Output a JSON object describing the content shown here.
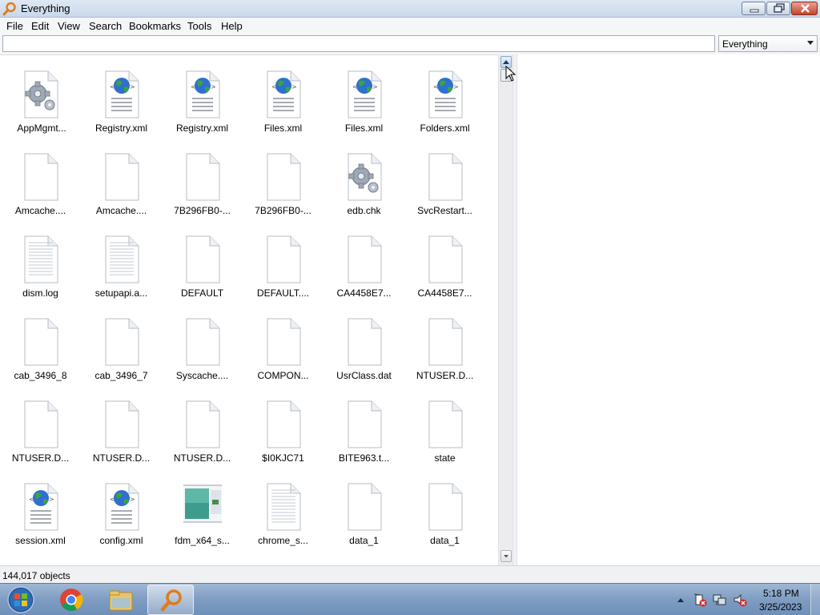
{
  "window": {
    "title": "Everything",
    "icon": "magnifier-icon"
  },
  "menu": [
    "File",
    "Edit",
    "View",
    "Search",
    "Bookmarks",
    "Tools",
    "Help"
  ],
  "search": {
    "value": "",
    "placeholder": "",
    "filter_selected": "Everything"
  },
  "results": [
    {
      "label": "AppMgmt...",
      "icon": "gear-file-icon"
    },
    {
      "label": "Registry.xml",
      "icon": "xml-globe-icon"
    },
    {
      "label": "Registry.xml",
      "icon": "xml-globe-icon"
    },
    {
      "label": "Files.xml",
      "icon": "xml-globe-icon"
    },
    {
      "label": "Files.xml",
      "icon": "xml-globe-icon"
    },
    {
      "label": "Folders.xml",
      "icon": "xml-globe-icon"
    },
    {
      "label": "Amcache....",
      "icon": "blank-file-icon"
    },
    {
      "label": "Amcache....",
      "icon": "blank-file-icon"
    },
    {
      "label": "7B296FB0-...",
      "icon": "blank-file-icon"
    },
    {
      "label": "7B296FB0-...",
      "icon": "blank-file-icon"
    },
    {
      "label": "edb.chk",
      "icon": "gear-file-icon"
    },
    {
      "label": "SvcRestart...",
      "icon": "blank-file-icon"
    },
    {
      "label": "dism.log",
      "icon": "text-file-icon"
    },
    {
      "label": "setupapi.a...",
      "icon": "text-file-icon"
    },
    {
      "label": "DEFAULT",
      "icon": "blank-file-icon"
    },
    {
      "label": "DEFAULT....",
      "icon": "blank-file-icon"
    },
    {
      "label": "CA4458E7...",
      "icon": "blank-file-icon"
    },
    {
      "label": "CA4458E7...",
      "icon": "blank-file-icon"
    },
    {
      "label": "cab_3496_8",
      "icon": "blank-file-icon"
    },
    {
      "label": "cab_3496_7",
      "icon": "blank-file-icon"
    },
    {
      "label": "Syscache....",
      "icon": "blank-file-icon"
    },
    {
      "label": "COMPON...",
      "icon": "blank-file-icon"
    },
    {
      "label": "UsrClass.dat",
      "icon": "blank-file-icon"
    },
    {
      "label": "NTUSER.D...",
      "icon": "blank-file-icon"
    },
    {
      "label": "NTUSER.D...",
      "icon": "blank-file-icon"
    },
    {
      "label": "NTUSER.D...",
      "icon": "blank-file-icon"
    },
    {
      "label": "NTUSER.D...",
      "icon": "blank-file-icon"
    },
    {
      "label": "$I0KJC71",
      "icon": "blank-file-icon"
    },
    {
      "label": "BITE963.t...",
      "icon": "blank-file-icon"
    },
    {
      "label": "state",
      "icon": "blank-file-icon"
    },
    {
      "label": "session.xml",
      "icon": "xml-globe-icon"
    },
    {
      "label": "config.xml",
      "icon": "xml-globe-icon"
    },
    {
      "label": "fdm_x64_s...",
      "icon": "image-thumbnail-icon"
    },
    {
      "label": "chrome_s...",
      "icon": "text-file-icon"
    },
    {
      "label": "data_1",
      "icon": "blank-file-icon"
    },
    {
      "label": "data_1",
      "icon": "blank-file-icon"
    }
  ],
  "status": {
    "count_text": "144,017 objects"
  },
  "taskbar": {
    "items": [
      "start-orb-icon",
      "chrome-icon",
      "file-explorer-icon",
      "everything-search-icon"
    ],
    "tray_icons": [
      "show-hidden-icons",
      "action-center-icon",
      "network-icon",
      "volume-muted-icon"
    ],
    "time": "5:18 PM",
    "date": "3/25/2023"
  },
  "colors": {
    "globe_blue": "#2f6fd1",
    "globe_green": "#3aa53a",
    "taskbar": "#7f9dc2",
    "close_red": "#c8432a"
  }
}
